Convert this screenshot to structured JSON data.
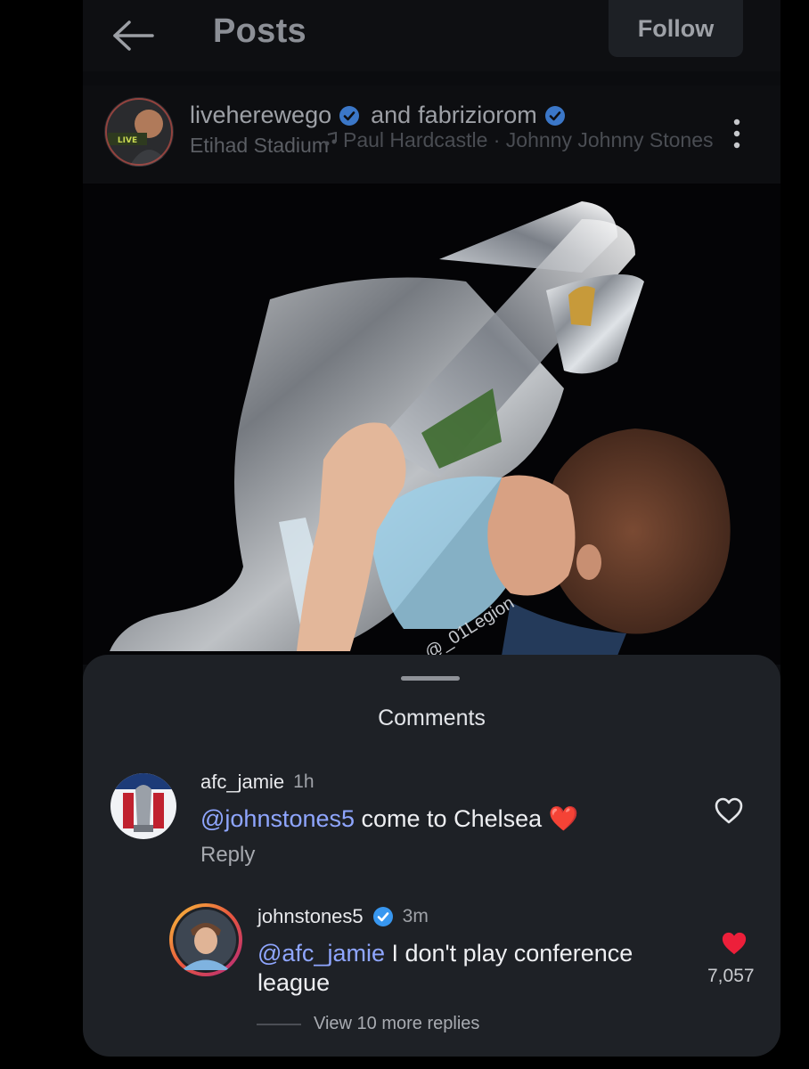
{
  "header": {
    "title": "Posts",
    "follow_label": "Follow"
  },
  "post": {
    "author1": "liveherewego",
    "author_joiner": "and",
    "author2": "fabriziorom",
    "location": "Etihad Stadium",
    "audio": "Paul Hardcastle · Johnny Johnny Stones",
    "watermark": "@_01Legion"
  },
  "comments": {
    "title": "Comments",
    "items": [
      {
        "user": "afc_jamie",
        "time": "1h",
        "mention": "@johnstones5",
        "text": " come to Chelsea ❤️",
        "reply_label": "Reply"
      },
      {
        "user": "johnstones5",
        "time": "3m",
        "mention": "@afc_jamie",
        "text": " I don't play conference league",
        "likes": "7,057"
      }
    ],
    "view_more": "View 10 more replies"
  },
  "colors": {
    "verified": "#3897f0",
    "mention": "#8fa6ff",
    "like_red": "#ed1f3a",
    "sheet_bg": "#1e2126"
  },
  "icons": [
    "back-arrow-icon",
    "verified-icon",
    "audio-icon",
    "more-vertical-icon",
    "heart-outline-icon",
    "heart-filled-icon"
  ]
}
